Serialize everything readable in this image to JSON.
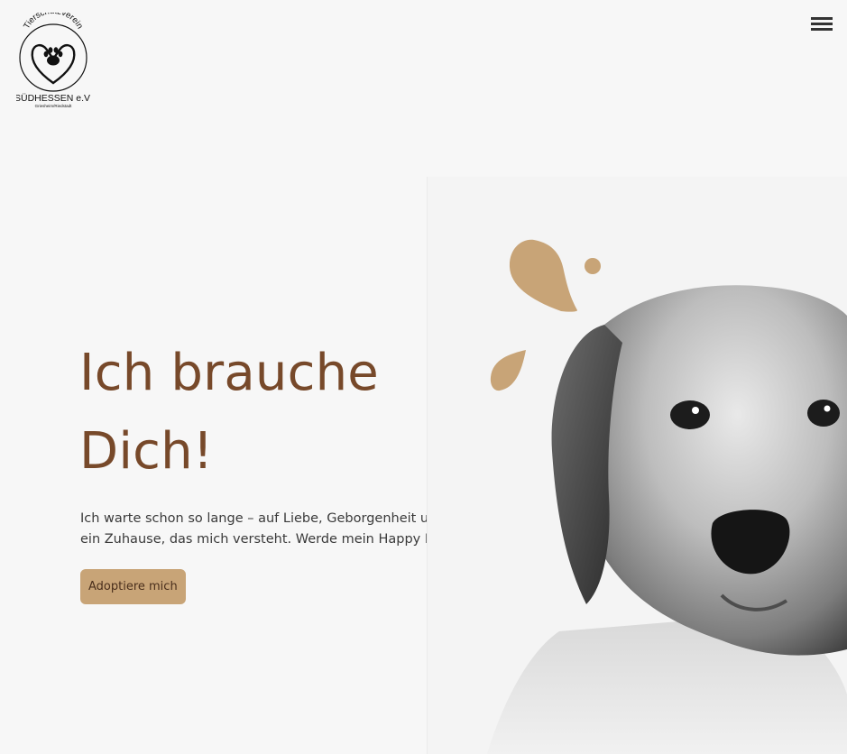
{
  "logo": {
    "arc_text": "Tierschutzverein",
    "name": "SÜDHESSEN e.V.",
    "location": "Griesheim/Riedstadt"
  },
  "header": {
    "menu_icon": "hamburger-menu-icon"
  },
  "hero": {
    "title_line1": "Ich brauche",
    "title_line2": "Dich!",
    "subtitle": "Ich warte schon so lange – auf Liebe, Geborgenheit und ein Zuhause, das mich versteht. Werde mein Happy End.",
    "cta_label": "Adoptiere mich"
  },
  "colors": {
    "background": "#f7f7f7",
    "title": "#77492a",
    "accent": "#c8a477",
    "text": "#3a3a3a"
  }
}
